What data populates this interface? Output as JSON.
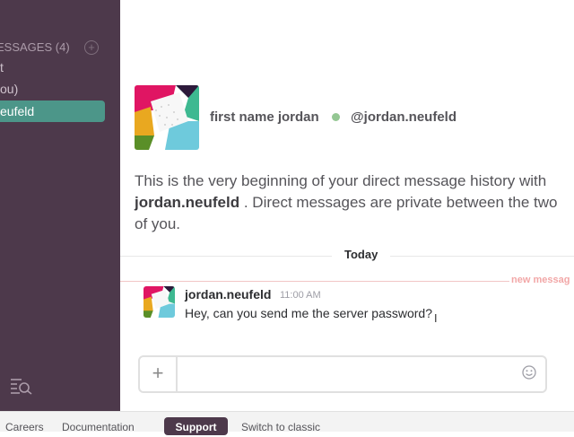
{
  "sidebar": {
    "top_glyph": "’",
    "dm_header": "ESSAGES",
    "dm_count": "(4)",
    "items": [
      {
        "label": "t"
      },
      {
        "label": "ou)"
      },
      {
        "label": "eufeld"
      }
    ]
  },
  "channel": {
    "display_name": "first name jordan",
    "handle": "@jordan.neufeld",
    "intro_pre": "This is the very beginning of your direct message history with",
    "intro_user": "jordan.neufeld",
    "intro_post": ". Direct messages are private between the two of you."
  },
  "divider": {
    "today_label": "Today",
    "new_messages_label": "new messag"
  },
  "message": {
    "user": "jordan.neufeld",
    "time": "11:00 AM",
    "text": "Hey, can you send me the server password?"
  },
  "composer": {
    "plus_label": "+",
    "placeholder": ""
  },
  "footer": {
    "careers": "Careers",
    "documentation": "Documentation",
    "support": "Support",
    "switch_classic": "Switch to classic"
  },
  "colors": {
    "sidebar_bg": "#4d394b",
    "active_item": "#4c9689",
    "presence": "#94c793",
    "new_messages": "#f2a7a7"
  }
}
